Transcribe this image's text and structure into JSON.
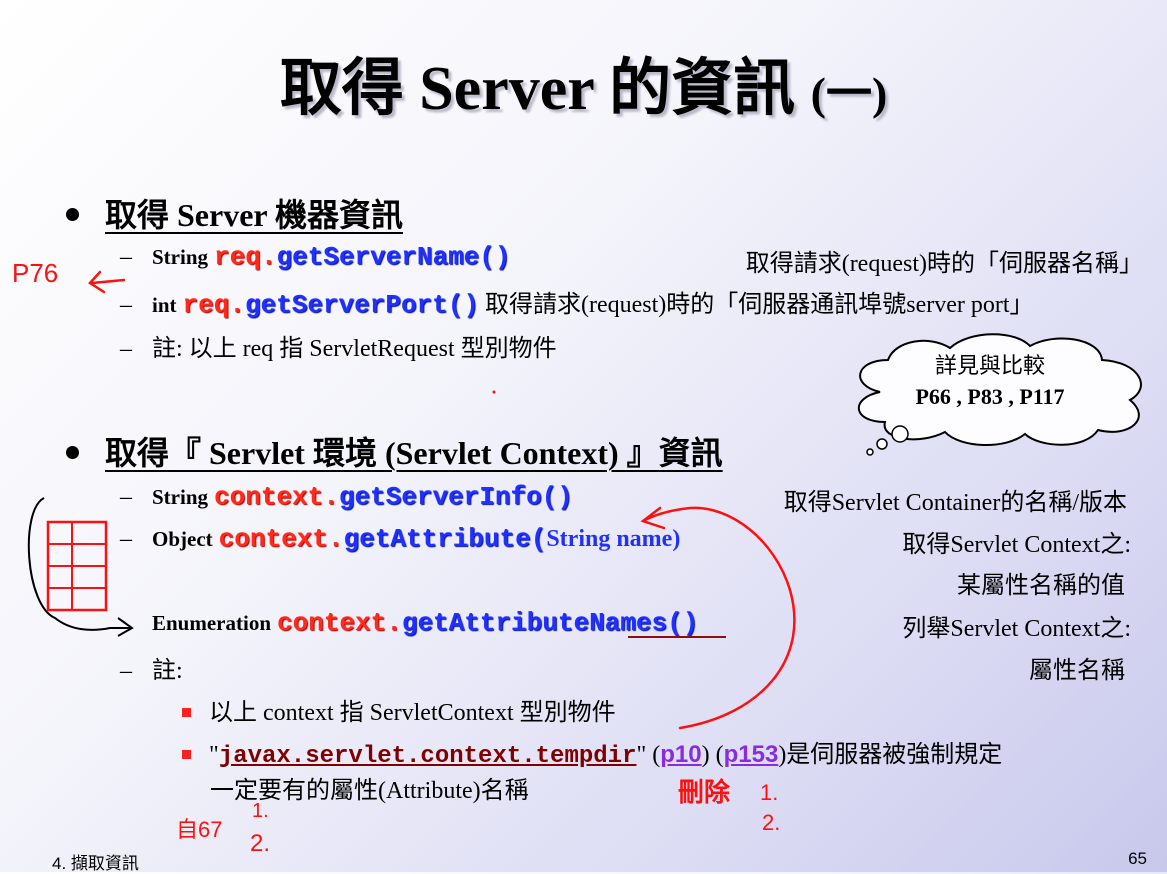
{
  "title": {
    "main": "取得 Server 的資訊",
    "paren": "(一)"
  },
  "bullet1": {
    "label": "取得 Server 機器資訊",
    "items": [
      {
        "type": "String",
        "obj": "req.",
        "method": "getServerName()",
        "desc": "取得請求(request)時的「伺服器名稱」"
      },
      {
        "type": "int",
        "obj": "req.",
        "method": "getServerPort()",
        "desc": "取得請求(request)時的「伺服器通訊埠號server port」"
      },
      {
        "text": "註: 以上 req 指 ServletRequest 型別物件"
      }
    ]
  },
  "cloud": {
    "line1": "詳見與比較",
    "line2": "P66 , P83 , P117"
  },
  "bullet2": {
    "label": "取得『 Servlet 環境 (Servlet Context) 』資訊",
    "items": [
      {
        "type": "String",
        "obj": "context.",
        "method": "getServerInfo()",
        "desc": "取得Servlet Container的名稱/版本"
      },
      {
        "type": "Object",
        "obj": "context.",
        "method": "getAttribute(",
        "arg": "String name)",
        "desc1": "取得Servlet Context之:",
        "desc2": "某屬性名稱的值"
      },
      {
        "type": "Enumeration",
        "obj": "context.",
        "method": "getAttributeNames()",
        "desc1": "列舉Servlet Context之:",
        "desc2": "屬性名稱"
      },
      {
        "text": "註:"
      }
    ],
    "notes": [
      {
        "text": "以上 context 指 ServletContext 型別物件"
      },
      {
        "q1": "\"",
        "code": "javax.servlet.context.tempdir",
        "q2": "\" (",
        "p1": "p10",
        "mid": ") (",
        "p2": "p153",
        "rest": ")是伺服器被強制規定",
        "line2": "一定要有的屬性(Attribute)名稱"
      }
    ]
  },
  "annotations": {
    "p76": "P76",
    "del": "刪除",
    "n1": "1.",
    "n2": "2.",
    "left": "自67",
    "l1": "1.",
    "l2": "2."
  },
  "footer": {
    "left": "4. 擷取資訊",
    "page": "65"
  },
  "colors": {
    "method": "#2030ff",
    "object": "#ff2a1a",
    "ink": "#ff1010"
  }
}
